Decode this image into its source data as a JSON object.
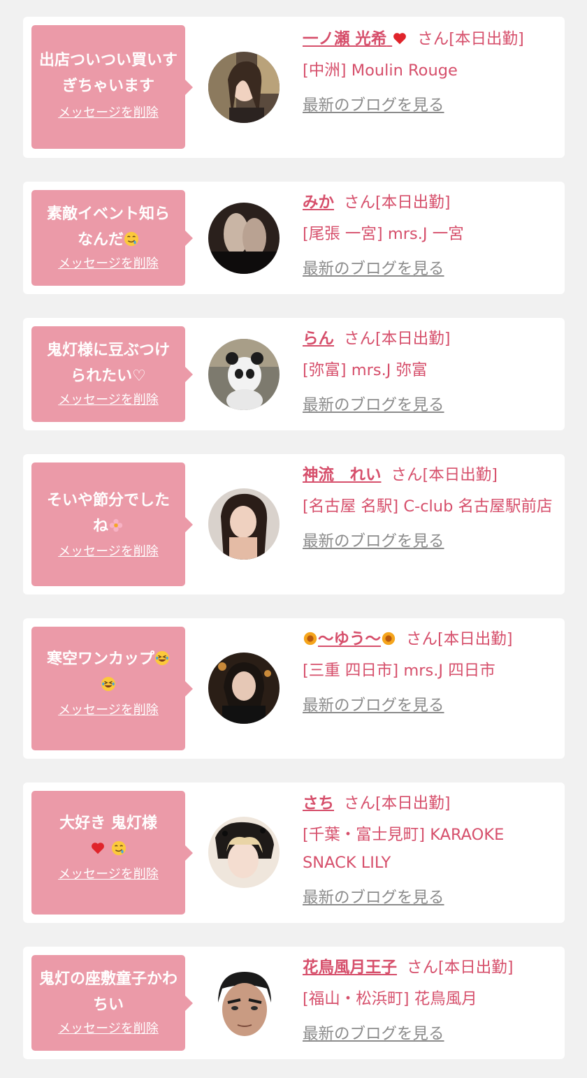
{
  "colors": {
    "page_bg": "#f1f1f1",
    "card_bg": "#ffffff",
    "bubble_bg": "#eb9aa8",
    "name_color": "#d64f6b",
    "blog_link_color": "#8b8b8b"
  },
  "delete_label": "メッセージを削除",
  "blog_label": "最新のブログを見る",
  "suffix_label": "さん[本日出勤]",
  "entries": [
    {
      "message": "出店ついつい買いすぎちゃいます",
      "name": "一ノ瀬 光希",
      "name_icon": "red-heart-icon",
      "shop": "[中洲] Moulin Rouge"
    },
    {
      "message": "素敵イベント知らなんだ",
      "message_icon": "drooling-face-icon",
      "name": "みか",
      "shop": "[尾張 一宮] mrs.J 一宮"
    },
    {
      "message": "鬼灯様に豆ぶつけられたい♡",
      "name": "らん",
      "shop": "[弥富] mrs.J 弥富"
    },
    {
      "message": "そいや節分でしたね",
      "message_icon": "flower-icon",
      "name": "神流　れい",
      "shop": "[名古屋 名駅] C-club 名古屋駅前店"
    },
    {
      "message": "寒空ワンカップ",
      "message_icon": "rolling-laughing-icon",
      "name": "〜ゆう〜",
      "name_icon": "sunflower-icon",
      "shop": "[三重 四日市] mrs.J 四日市"
    },
    {
      "message": "大好き 鬼灯様",
      "message_icon": "red-heart-icon",
      "message_icon_2": "drooling-face-icon",
      "name": "さち",
      "shop": "[千葉・富士見町] KARAOKE SNACK LILY"
    },
    {
      "message": "鬼灯の座敷童子かわちい",
      "name": "花鳥風月王子",
      "shop": "[福山・松浜町] 花鳥風月"
    }
  ]
}
